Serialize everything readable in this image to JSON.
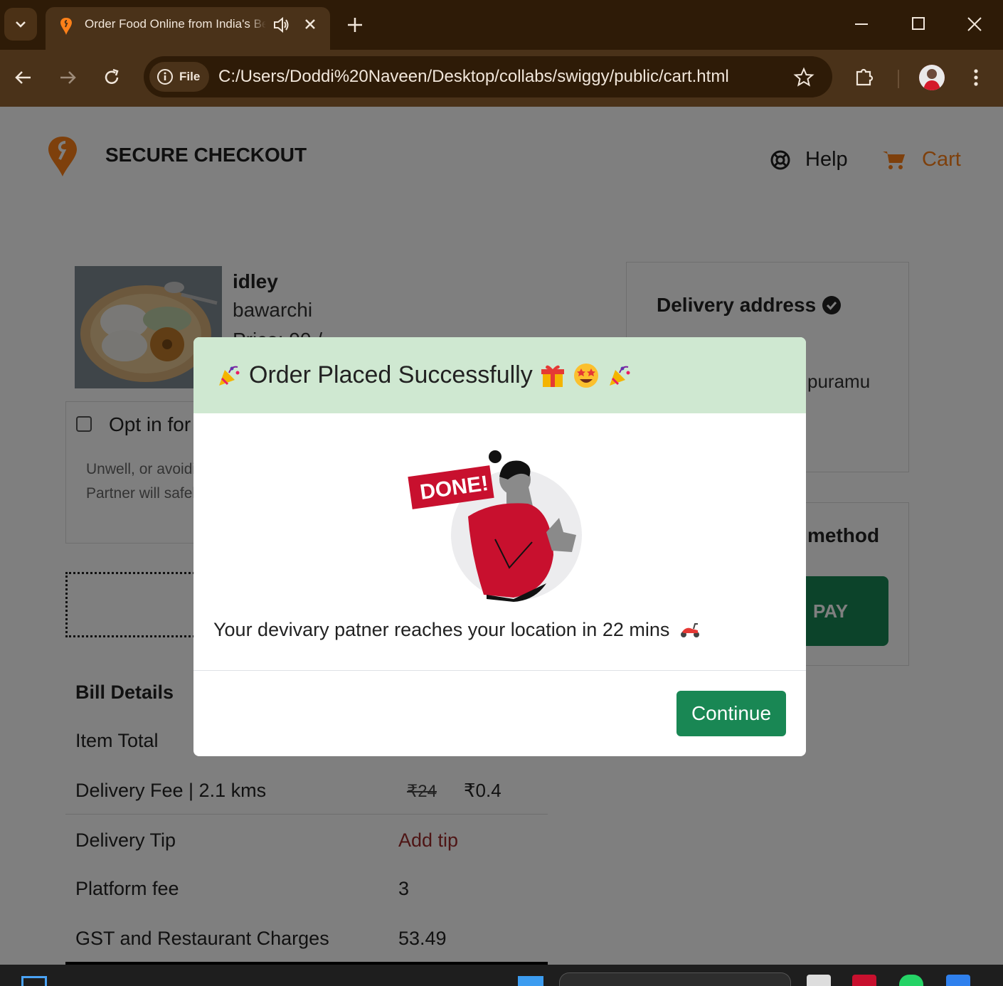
{
  "browser": {
    "tab_title": "Order Food Online from India's Best Food Delivery Service | Swiggy",
    "address_chip": "File",
    "url": "C:/Users/Doddi%20Naveen/Desktop/collabs/swiggy/public/cart.html"
  },
  "header": {
    "title": "SECURE CHECKOUT",
    "help_label": "Help",
    "cart_label": "Cart"
  },
  "cart_item": {
    "name": "idley",
    "restaurant": "bawarchi",
    "price_partial": "Price: 90 /-"
  },
  "optin": {
    "label": "Opt in for No-contact Delivery",
    "desc_line1": "Unwell, or avoiding contact? Please select no-contact delivery.",
    "desc_line2": "Partner will safely place the order outside your door (not for COD)"
  },
  "address": {
    "title": "Delivery address",
    "line_partial": "puramu"
  },
  "payment": {
    "title_partial": "method",
    "pay_label": "PAY"
  },
  "bill": {
    "title": "Bill Details",
    "item_total_label": "Item Total",
    "delivery_fee_label": "Delivery Fee | 2.1 kms",
    "delivery_fee_original": "₹24",
    "delivery_fee_value": "₹0.4",
    "tip_label": "Delivery Tip",
    "tip_action": "Add tip",
    "platform_label": "Platform fee",
    "platform_value": "3",
    "gst_label": "GST and Restaurant Charges",
    "gst_value": "53.49"
  },
  "modal": {
    "title": "Order Placed Successfully",
    "badge": "DONE!",
    "message": "Your devivary patner reaches your location in 22 mins",
    "continue_label": "Continue"
  },
  "colors": {
    "brand": "#fc8019",
    "success": "#198754",
    "modal_header": "#cfe8d1"
  }
}
